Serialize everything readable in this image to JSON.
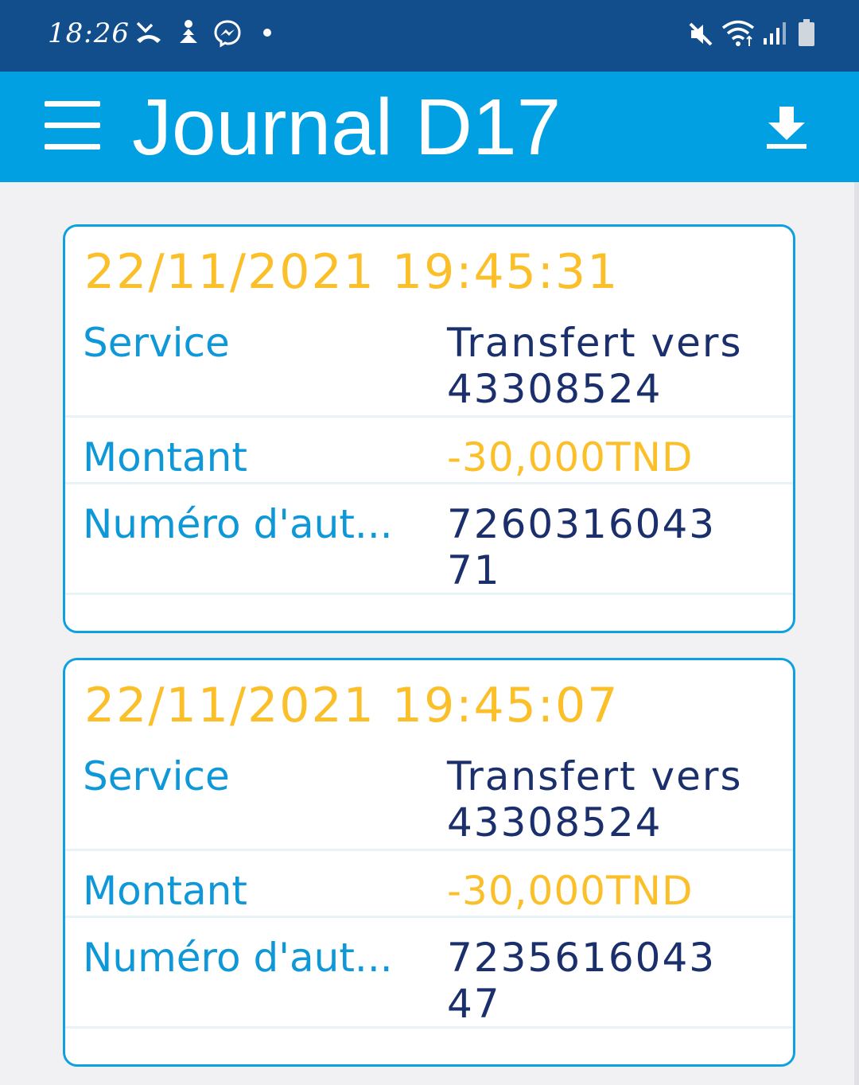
{
  "status_bar": {
    "time": "18:26",
    "icons": [
      "missed-call-icon",
      "meditation-icon",
      "messenger-icon",
      "dot-icon",
      "mute-icon",
      "wifi-icon",
      "signal-icon",
      "battery-icon"
    ]
  },
  "app_bar": {
    "title": "Journal D17",
    "menu_icon": "hamburger-menu-icon",
    "download_icon": "download-icon"
  },
  "colors": {
    "status_bar": "#134e8c",
    "app_bar": "#00a0e3",
    "date": "#fbbf2a",
    "label": "#0f98d8",
    "value": "#1a2f6b",
    "card_border": "#0ea0df"
  },
  "transactions": [
    {
      "datetime": "22/11/2021 19:45:31",
      "service_label": "Service",
      "service_value": "Transfert vers 43308524",
      "amount_label": "Montant",
      "amount_value": "-30,000TND",
      "auth_label": "Numéro d'aut...",
      "auth_value": "726031604371"
    },
    {
      "datetime": "22/11/2021 19:45:07",
      "service_label": "Service",
      "service_value": "Transfert vers 43308524",
      "amount_label": "Montant",
      "amount_value": "-30,000TND",
      "auth_label": "Numéro d'aut...",
      "auth_value": "723561604347"
    }
  ]
}
